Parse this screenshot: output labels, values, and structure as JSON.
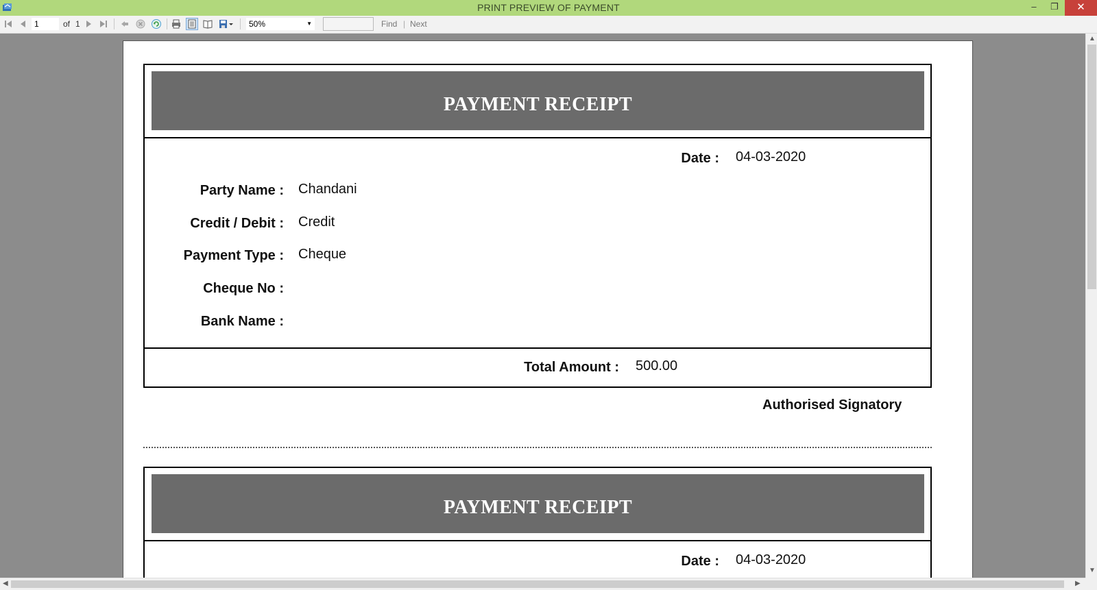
{
  "window": {
    "title": "PRINT PREVIEW OF PAYMENT",
    "minimize_glyph": "–",
    "restore_glyph": "❐",
    "close_glyph": "✕"
  },
  "toolbar": {
    "current_page": "1",
    "page_of_label": "of",
    "total_pages": "1",
    "zoom": "50%",
    "find_label": "Find",
    "separator": "|",
    "next_label": "Next"
  },
  "receipts": [
    {
      "title": "PAYMENT RECEIPT",
      "date_label": "Date :",
      "date_value": "04-03-2020",
      "party_name_label": "Party Name :",
      "party_name_value": "Chandani",
      "credit_debit_label": "Credit / Debit :",
      "credit_debit_value": "Credit",
      "payment_type_label": "Payment Type :",
      "payment_type_value": "Cheque",
      "cheque_no_label": "Cheque No :",
      "cheque_no_value": "",
      "bank_name_label": "Bank Name :",
      "bank_name_value": "",
      "total_amount_label": "Total Amount :",
      "total_amount_value": "500.00",
      "signatory": "Authorised Signatory"
    },
    {
      "title": "PAYMENT RECEIPT",
      "date_label": "Date :",
      "date_value": "04-03-2020"
    }
  ],
  "colors": {
    "titlebar": "#b1d87c",
    "banner": "#6b6b6b",
    "viewport_bg": "#8c8c8c",
    "close_button": "#c7413a"
  },
  "icons": [
    "app-icon",
    "first-page-icon",
    "prev-page-icon",
    "next-page-icon",
    "last-page-icon",
    "back-icon",
    "stop-icon",
    "refresh-icon",
    "print-icon",
    "print-layout-icon",
    "page-setup-icon",
    "export-icon"
  ]
}
